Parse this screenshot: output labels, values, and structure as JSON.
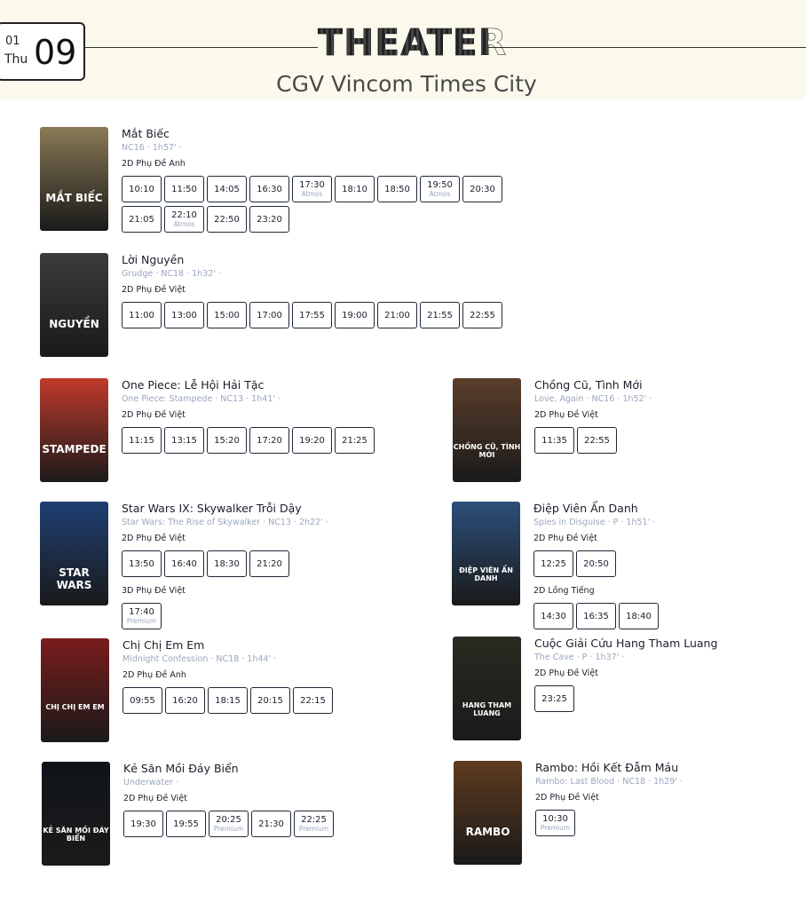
{
  "date": {
    "month": "01",
    "dow": "Thu",
    "day": "09"
  },
  "logo_text": "THEATER",
  "cinema_name": "CGV Vincom Times City",
  "movies": [
    {
      "title": "Mắt Biếc",
      "sub": "NC16 · 1h57' ·",
      "poster_text": "MẮT BIẾC",
      "formats": [
        {
          "name": "2D Phụ Đề Anh",
          "times": [
            {
              "t": "10:10",
              "tag": ""
            },
            {
              "t": "11:50",
              "tag": ""
            },
            {
              "t": "14:05",
              "tag": ""
            },
            {
              "t": "16:30",
              "tag": ""
            },
            {
              "t": "17:30",
              "tag": "Atmos"
            },
            {
              "t": "18:10",
              "tag": ""
            },
            {
              "t": "18:50",
              "tag": ""
            },
            {
              "t": "19:50",
              "tag": "Atmos"
            },
            {
              "t": "20:30",
              "tag": ""
            },
            {
              "t": "21:05",
              "tag": ""
            },
            {
              "t": "22:10",
              "tag": "Atmos"
            },
            {
              "t": "22:50",
              "tag": ""
            },
            {
              "t": "23:20",
              "tag": ""
            }
          ]
        }
      ]
    },
    {
      "title": "Lời Nguyền",
      "sub": "Grudge · NC18 · 1h32' ·",
      "poster_text": "NGUYỀN",
      "formats": [
        {
          "name": "2D Phụ Đề Việt",
          "times": [
            {
              "t": "11:00",
              "tag": ""
            },
            {
              "t": "13:00",
              "tag": ""
            },
            {
              "t": "15:00",
              "tag": ""
            },
            {
              "t": "17:00",
              "tag": ""
            },
            {
              "t": "17:55",
              "tag": ""
            },
            {
              "t": "19:00",
              "tag": ""
            },
            {
              "t": "21:00",
              "tag": ""
            },
            {
              "t": "21:55",
              "tag": ""
            },
            {
              "t": "22:55",
              "tag": ""
            }
          ]
        }
      ]
    },
    {
      "title": "One Piece: Lễ Hội Hải Tặc",
      "sub": "One Piece: Stampede · NC13 · 1h41' ·",
      "poster_text": "STAMPEDE",
      "formats": [
        {
          "name": "2D Phụ Đề Việt",
          "times": [
            {
              "t": "11:15",
              "tag": ""
            },
            {
              "t": "13:15",
              "tag": ""
            },
            {
              "t": "15:20",
              "tag": ""
            },
            {
              "t": "17:20",
              "tag": ""
            },
            {
              "t": "19:20",
              "tag": ""
            },
            {
              "t": "21:25",
              "tag": ""
            }
          ]
        }
      ]
    },
    {
      "title": "Chồng Cũ, Tình Mới",
      "sub": "Love, Again · NC16 · 1h52' ·",
      "poster_text": "CHỒNG CŨ, TÌNH MỚI",
      "formats": [
        {
          "name": "2D Phụ Đề Việt",
          "times": [
            {
              "t": "11:35",
              "tag": ""
            },
            {
              "t": "22:55",
              "tag": ""
            }
          ]
        }
      ]
    },
    {
      "title": "Star Wars IX: Skywalker Trỗi Dậy",
      "sub": "Star Wars: The Rise of Skywalker · NC13 · 2h22' ·",
      "poster_text": "STAR WARS",
      "formats": [
        {
          "name": "2D Phụ Đề Việt",
          "times": [
            {
              "t": "13:50",
              "tag": ""
            },
            {
              "t": "16:40",
              "tag": ""
            },
            {
              "t": "18:30",
              "tag": ""
            },
            {
              "t": "21:20",
              "tag": ""
            }
          ]
        },
        {
          "name": "3D Phụ Đề Việt",
          "times": [
            {
              "t": "17:40",
              "tag": "Premium"
            }
          ]
        }
      ]
    },
    {
      "title": "Điệp Viên Ẩn Danh",
      "sub": "Spies in Disguise · P · 1h51' ·",
      "poster_text": "ĐIỆP VIÊN ẨN DANH",
      "formats": [
        {
          "name": "2D Phụ Đề Việt",
          "times": [
            {
              "t": "12:25",
              "tag": ""
            },
            {
              "t": "20:50",
              "tag": ""
            }
          ]
        },
        {
          "name": "2D Lồng Tiếng",
          "times": [
            {
              "t": "14:30",
              "tag": ""
            },
            {
              "t": "16:35",
              "tag": ""
            },
            {
              "t": "18:40",
              "tag": ""
            }
          ]
        }
      ]
    },
    {
      "title": "Chị Chị Em Em",
      "sub": "Midnight Confession · NC18 · 1h44' ·",
      "poster_text": "CHỊ CHỊ EM EM",
      "formats": [
        {
          "name": "2D Phụ Đề Anh",
          "times": [
            {
              "t": "09:55",
              "tag": ""
            },
            {
              "t": "16:20",
              "tag": ""
            },
            {
              "t": "18:15",
              "tag": ""
            },
            {
              "t": "20:15",
              "tag": ""
            },
            {
              "t": "22:15",
              "tag": ""
            }
          ]
        }
      ]
    },
    {
      "title": "Cuộc Giải Cứu Hang Tham Luang",
      "sub": "The Cave · P · 1h37' ·",
      "poster_text": "HANG THAM LUANG",
      "formats": [
        {
          "name": "2D Phụ Đề Việt",
          "times": [
            {
              "t": "23:25",
              "tag": ""
            }
          ]
        }
      ]
    },
    {
      "title": "Kẻ Săn Mồi Đáy Biển",
      "sub": "Underwater ·",
      "poster_text": "KẺ SĂN MỒI ĐÁY BIỂN",
      "formats": [
        {
          "name": "2D Phụ Đề Việt",
          "times": [
            {
              "t": "19:30",
              "tag": ""
            },
            {
              "t": "19:55",
              "tag": ""
            },
            {
              "t": "20:25",
              "tag": "Premium"
            },
            {
              "t": "21:30",
              "tag": ""
            },
            {
              "t": "22:25",
              "tag": "Premium"
            }
          ]
        }
      ]
    },
    {
      "title": "Rambo: Hồi Kết Đẫm Máu",
      "sub": "Rambo: Last Blood · NC18 · 1h29' ·",
      "poster_text": "RAMBO",
      "formats": [
        {
          "name": "2D Phụ Đề Việt",
          "times": [
            {
              "t": "10:30",
              "tag": "Premium"
            }
          ]
        }
      ]
    }
  ],
  "poster_colors": [
    "#8a7a55",
    "#3b3b3b",
    "#c0392b",
    "#5a3e2b",
    "#1f3f73",
    "#2c4f7a",
    "#7a1c1c",
    "#2a2a22",
    "#10141a",
    "#5e3b1e"
  ]
}
